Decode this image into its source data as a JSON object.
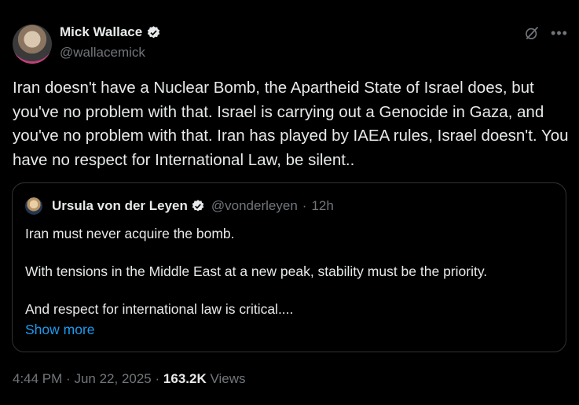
{
  "author": {
    "name": "Mick Wallace",
    "handle": "@wallacemick"
  },
  "tweet_text": "Iran doesn't have a Nuclear Bomb, the Apartheid State of Israel does, but you've no problem with that. Israel is carrying out a Genocide in Gaza, and you've no problem with that. Iran has played by IAEA rules, Israel doesn't. You have no respect for International Law, be silent..",
  "quote": {
    "name": "Ursula von der Leyen",
    "handle": "@vonderleyen",
    "separator": "·",
    "time": "12h",
    "paragraphs": [
      "Iran must never acquire the bomb.",
      "With tensions in the Middle East at a new peak, stability must be the priority.",
      "And respect for international law is critical...."
    ],
    "show_more": "Show more"
  },
  "footer": {
    "time": "4:44 PM",
    "sep1": "·",
    "date": "Jun 22, 2025",
    "sep2": "·",
    "views_count": "163.2K",
    "views_label": "Views"
  },
  "icons": {
    "verified": "verified-badge-icon",
    "grok": "grok-icon",
    "more": "more-icon"
  },
  "colors": {
    "background": "#000000",
    "text": "#e7e9ea",
    "secondary": "#71767b",
    "link": "#1d9bf0",
    "border": "#2f3336"
  }
}
